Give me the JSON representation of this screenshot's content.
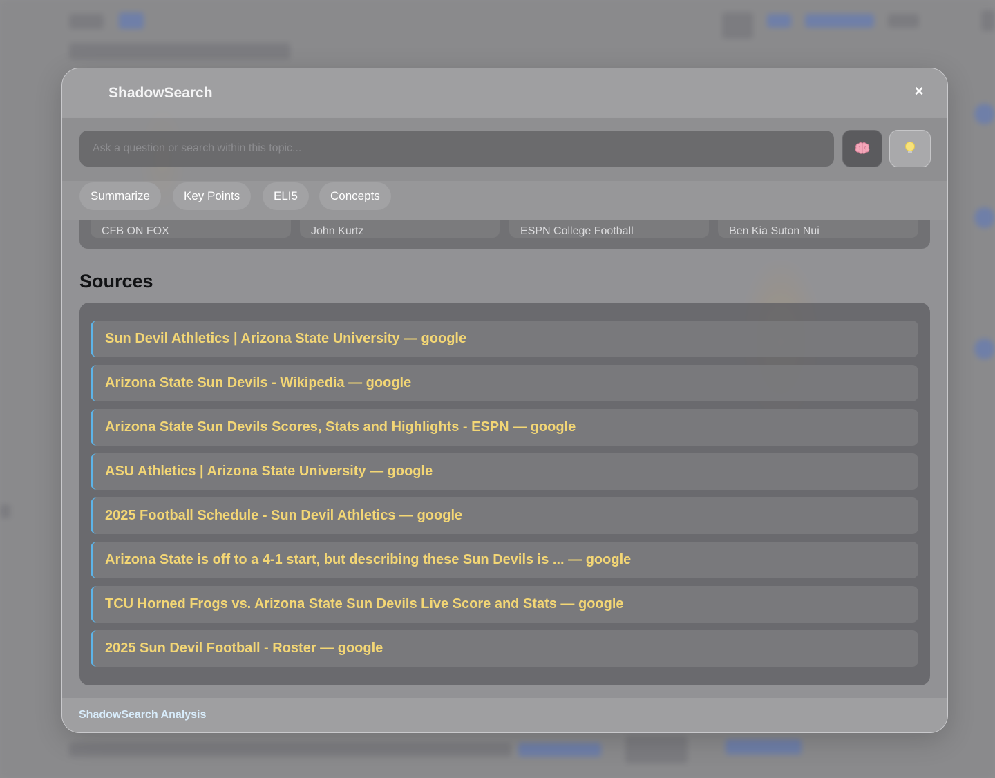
{
  "modal": {
    "title": "ShadowSearch",
    "close_label": "×",
    "search": {
      "placeholder": "Ask a question or search within this topic...",
      "value": ""
    },
    "actions": {
      "brain_icon": "brain-icon",
      "bulb_icon": "lightbulb-icon"
    },
    "chips": [
      {
        "label": "Summarize"
      },
      {
        "label": "Key Points"
      },
      {
        "label": "ELI5"
      },
      {
        "label": "Concepts"
      }
    ],
    "related": [
      {
        "label": "CFB ON FOX"
      },
      {
        "label": "John Kurtz"
      },
      {
        "label": "ESPN College Football"
      },
      {
        "label": "Ben Kia Suton Nui"
      }
    ],
    "sources_heading": "Sources",
    "sources": [
      {
        "label": "Sun Devil Athletics | Arizona State University — google"
      },
      {
        "label": "Arizona State Sun Devils - Wikipedia — google"
      },
      {
        "label": "Arizona State Sun Devils Scores, Stats and Highlights - ESPN — google"
      },
      {
        "label": "ASU Athletics | Arizona State University — google"
      },
      {
        "label": "2025 Football Schedule - Sun Devil Athletics — google"
      },
      {
        "label": "Arizona State is off to a 4-1 start, but describing these Sun Devils is ... — google"
      },
      {
        "label": "TCU Horned Frogs vs. Arizona State Sun Devils Live Score and Stats — google"
      },
      {
        "label": "2025 Sun Devil Football - Roster — google"
      }
    ],
    "footer": "ShadowSearch Analysis"
  },
  "colors": {
    "source_link": "#f3d675",
    "source_accent": "#5db4e8",
    "footer_text": "#d8ecfb"
  }
}
